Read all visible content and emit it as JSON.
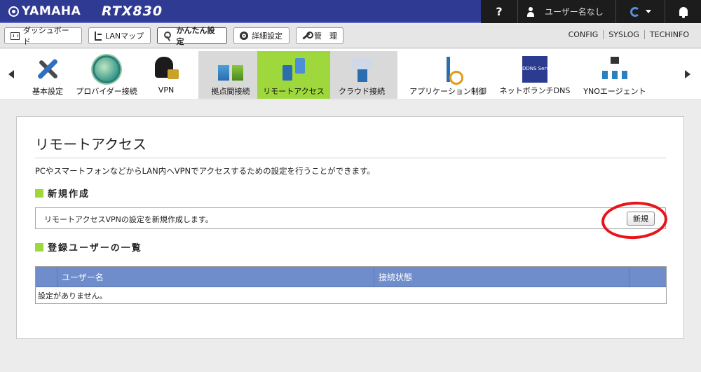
{
  "header": {
    "brand": "YAMAHA",
    "model": "RTX830",
    "help_label": "?",
    "user_label": "ユーザー名なし",
    "colors": {
      "topbar": "#2f3a93",
      "topbar_dark": "#1c1c1c"
    }
  },
  "nav": {
    "buttons": [
      {
        "label": "ダッシュボード",
        "icon": "dashboard-icon"
      },
      {
        "label": "LANマップ",
        "icon": "lan-map-icon"
      },
      {
        "label": "かんたん設定",
        "icon": "wizard-icon",
        "active": true
      },
      {
        "label": "詳細設定",
        "icon": "gear-icon"
      },
      {
        "label": "管　理",
        "icon": "wrench-icon"
      }
    ],
    "links": [
      "CONFIG",
      "SYSLOG",
      "TECHINFO"
    ]
  },
  "menu": {
    "items": [
      {
        "label": "基本設定",
        "icon": "tools-icon"
      },
      {
        "label": "プロバイダー接続",
        "icon": "globe-icon"
      },
      {
        "label": "VPN",
        "icon": "vpn-lock-icon"
      },
      {
        "label": "拠点間接続",
        "icon": "site-connection-icon"
      },
      {
        "label": "リモートアクセス",
        "icon": "remote-access-icon",
        "active": true
      },
      {
        "label": "クラウド接続",
        "icon": "cloud-icon"
      },
      {
        "label": "アプリケーション制御",
        "icon": "app-control-icon"
      },
      {
        "label": "ネットボランチDNS",
        "icon": "ddns-icon"
      },
      {
        "label": "YNOエージェント",
        "icon": "yno-agent-icon"
      }
    ],
    "ddns_text": "DDNS Service",
    "active_color": "#9ed83c"
  },
  "main": {
    "title": "リモートアクセス",
    "description": "PCやスマートフォンなどからLAN内へVPNでアクセスするための設定を行うことができます。",
    "create_section": {
      "heading": "新規作成",
      "text": "リモートアクセスVPNの設定を新規作成します。",
      "button_label": "新規"
    },
    "users_section": {
      "heading": "登録ユーザーの一覧",
      "columns": [
        "",
        "ユーザー名",
        "接続状態",
        ""
      ],
      "empty_text": "設定がありません。"
    },
    "annotation_color": "#e8141b"
  }
}
